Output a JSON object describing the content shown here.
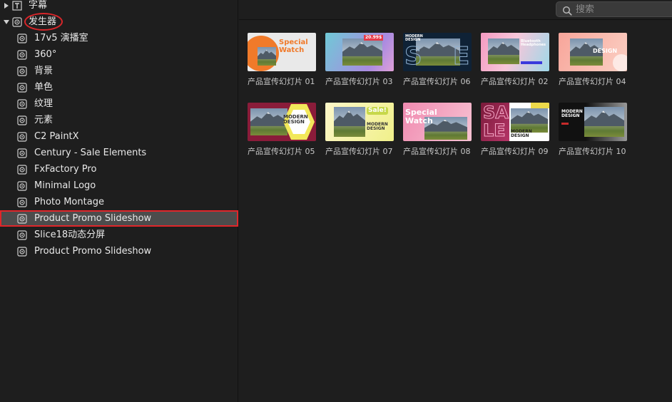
{
  "sidebar": {
    "categories": [
      {
        "label": "字幕",
        "expanded": false
      },
      {
        "label": "发生器",
        "expanded": true
      }
    ],
    "items": [
      {
        "label": "17v5 演播室"
      },
      {
        "label": "360°"
      },
      {
        "label": "背景"
      },
      {
        "label": "单色"
      },
      {
        "label": "纹理"
      },
      {
        "label": "元素"
      },
      {
        "label": "C2 PaintX"
      },
      {
        "label": "Century - Sale Elements"
      },
      {
        "label": "FxFactory Pro"
      },
      {
        "label": "Minimal Logo"
      },
      {
        "label": "Photo Montage"
      },
      {
        "label": "Product Promo Slideshow",
        "selected": true
      },
      {
        "label": "Slice18动态分屏"
      },
      {
        "label": "Product Promo Slideshow"
      }
    ]
  },
  "search": {
    "placeholder": "搜索",
    "value": ""
  },
  "thumbnails": [
    {
      "caption": "产品宣传幻灯片 01",
      "text": "Special Watch"
    },
    {
      "caption": "产品宣传幻灯片 03",
      "text": "20.99$"
    },
    {
      "caption": "产品宣传幻灯片 06",
      "text": "MODERN DESIGN"
    },
    {
      "caption": "产品宣传幻灯片 02",
      "text": "Bluetooth Headphones"
    },
    {
      "caption": "产品宣传幻灯片 04",
      "text": "MODERN DESIGN"
    },
    {
      "caption": "产品宣传幻灯片 05",
      "text": "MODERN DESIGN"
    },
    {
      "caption": "产品宣传幻灯片 07",
      "text": "Sale! MODERN DESIGN"
    },
    {
      "caption": "产品宣传幻灯片 08",
      "text": "Special Watch"
    },
    {
      "caption": "产品宣传幻灯片 09",
      "text": "SALE MODERN DESIGN"
    },
    {
      "caption": "产品宣传幻灯片 10",
      "text": "MODERN DESIGN"
    }
  ],
  "colors": {
    "selection": "#4c4c4c",
    "annotation": "#d8262a"
  }
}
